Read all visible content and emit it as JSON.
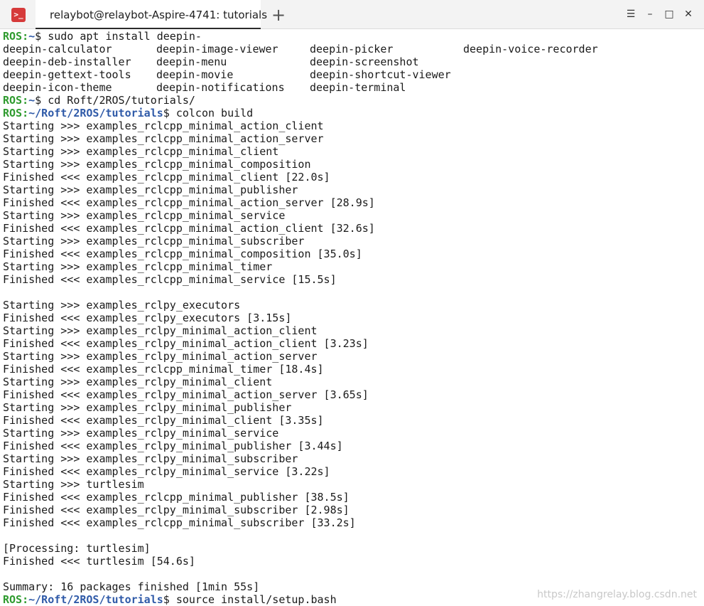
{
  "titlebar": {
    "app_icon": "terminal-icon",
    "app_icon_glyph": ">_",
    "tab_title": "relaybot@relaybot-Aspire-4741: tutorials",
    "new_tab_icon": "+",
    "menu_icon": "☰",
    "min_icon": "–",
    "max_icon": "□",
    "close_icon": "✕"
  },
  "terminal": {
    "prompt_user": "ROS:",
    "prompt_home": "~",
    "prompt_path": "~/Roft/2ROS/tutorials",
    "cmd1": "$ sudo apt install deepin-",
    "completions": [
      [
        "deepin-calculator",
        "deepin-image-viewer",
        "deepin-picker",
        "deepin-voice-recorder"
      ],
      [
        "deepin-deb-installer",
        "deepin-menu",
        "deepin-screenshot",
        ""
      ],
      [
        "deepin-gettext-tools",
        "deepin-movie",
        "deepin-shortcut-viewer",
        ""
      ],
      [
        "deepin-icon-theme",
        "deepin-notifications",
        "deepin-terminal",
        ""
      ]
    ],
    "cmd2": "$ cd Roft/2ROS/tutorials/",
    "cmd3": "$ colcon build",
    "output": [
      "Starting >>> examples_rclcpp_minimal_action_client",
      "Starting >>> examples_rclcpp_minimal_action_server",
      "Starting >>> examples_rclcpp_minimal_client",
      "Starting >>> examples_rclcpp_minimal_composition",
      "Finished <<< examples_rclcpp_minimal_client [22.0s]",
      "Starting >>> examples_rclcpp_minimal_publisher",
      "Finished <<< examples_rclcpp_minimal_action_server [28.9s]",
      "Starting >>> examples_rclcpp_minimal_service",
      "Finished <<< examples_rclcpp_minimal_action_client [32.6s]",
      "Starting >>> examples_rclcpp_minimal_subscriber",
      "Finished <<< examples_rclcpp_minimal_composition [35.0s]",
      "Starting >>> examples_rclcpp_minimal_timer",
      "Finished <<< examples_rclcpp_minimal_service [15.5s]",
      "",
      "Starting >>> examples_rclpy_executors",
      "Finished <<< examples_rclpy_executors [3.15s]",
      "Starting >>> examples_rclpy_minimal_action_client",
      "Finished <<< examples_rclpy_minimal_action_client [3.23s]",
      "Starting >>> examples_rclpy_minimal_action_server",
      "Finished <<< examples_rclcpp_minimal_timer [18.4s]",
      "Starting >>> examples_rclpy_minimal_client",
      "Finished <<< examples_rclpy_minimal_action_server [3.65s]",
      "Starting >>> examples_rclpy_minimal_publisher",
      "Finished <<< examples_rclpy_minimal_client [3.35s]",
      "Starting >>> examples_rclpy_minimal_service",
      "Finished <<< examples_rclpy_minimal_publisher [3.44s]",
      "Starting >>> examples_rclpy_minimal_subscriber",
      "Finished <<< examples_rclpy_minimal_service [3.22s]",
      "Starting >>> turtlesim",
      "Finished <<< examples_rclcpp_minimal_publisher [38.5s]",
      "Finished <<< examples_rclpy_minimal_subscriber [2.98s]",
      "Finished <<< examples_rclcpp_minimal_subscriber [33.2s]",
      "",
      "[Processing: turtlesim]",
      "Finished <<< turtlesim [54.6s]",
      "",
      "Summary: 16 packages finished [1min 55s]"
    ],
    "cmd4": "$ source install/setup.bash"
  },
  "watermark": "https://zhangrelay.blog.csdn.net"
}
